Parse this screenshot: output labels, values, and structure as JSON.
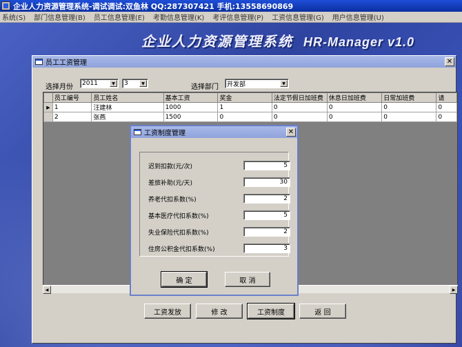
{
  "app": {
    "title": "企业人力资源管理系统-调试调试:双鱼林  QQ:287307421 手机:13558690869",
    "banner_cn": "企业人力资源管理系统",
    "banner_en": "HR-Manager v1.0"
  },
  "menu": [
    {
      "label": "系统(S)"
    },
    {
      "label": "部门信息管理(B)"
    },
    {
      "label": "员工信息管理(E)"
    },
    {
      "label": "考勤信息管理(K)"
    },
    {
      "label": "考评信息管理(P)"
    },
    {
      "label": "工资信息管理(G)"
    },
    {
      "label": "用户信息管理(U)"
    }
  ],
  "main_window": {
    "title": "员工工资管理",
    "close_glyph": "✕",
    "month_label": "选择月份",
    "year_value": "2011",
    "month_value": "3",
    "dept_label": "选择部门",
    "dept_value": "开发部",
    "columns": [
      "员工编号",
      "员工姓名",
      "基本工资",
      "奖金",
      "法定节假日加班费",
      "休息日加班费",
      "日常加班费",
      "请"
    ],
    "rows": [
      {
        "indicator": "▶",
        "cells": [
          "1",
          "汪建林",
          "1000",
          "1",
          "0",
          "0",
          "0",
          "0"
        ]
      },
      {
        "indicator": "",
        "cells": [
          "2",
          "张燕",
          "1500",
          "0",
          "0",
          "0",
          "0",
          "0"
        ]
      }
    ],
    "buttons": {
      "pay": "工资发放",
      "edit": "修 改",
      "system": "工资制度",
      "back": "返 回"
    }
  },
  "dialog": {
    "title": "工资制度管理",
    "close_glyph": "✕",
    "fields": [
      {
        "label": "迟到扣款(元/次)",
        "value": "5"
      },
      {
        "label": "差旅补助(元/天)",
        "value": "30"
      },
      {
        "label": "养老代扣系数(%)",
        "value": "2"
      },
      {
        "label": "基本医疗代扣系数(%)",
        "value": "5"
      },
      {
        "label": "失业保险代扣系数(%)",
        "value": "2"
      },
      {
        "label": "住房公积金代扣系数(%)",
        "value": "3"
      }
    ],
    "ok_label": "确 定",
    "cancel_label": "取 消"
  }
}
